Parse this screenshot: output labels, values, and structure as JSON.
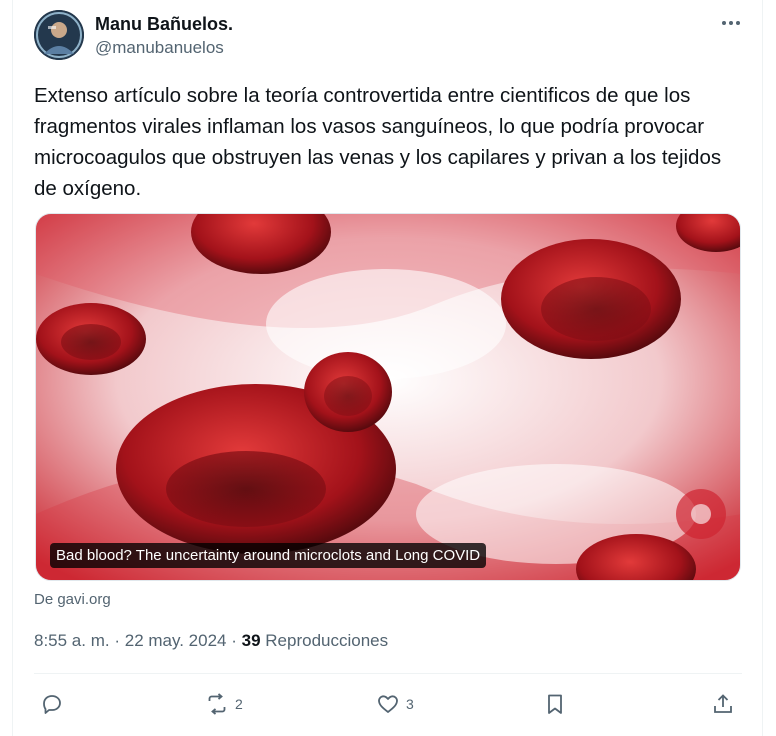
{
  "author": {
    "name": "Manu Bañuelos.",
    "handle": "@manubanuelos"
  },
  "post": {
    "text": "Extenso artículo sobre la teoría controvertida entre cientificos de que los fragmentos virales inflaman los vasos sanguíneos, lo que podría provocar microcoagulos que obstruyen las venas y los capilares y privan a los tejidos de oxígeno.",
    "card": {
      "caption": "Bad blood? The uncertainty around microclots and Long COVID",
      "source": "De gavi.org"
    },
    "time": "8:55 a. m.",
    "date": "22 may. 2024",
    "views_count": "39",
    "views_label": "Reproducciones"
  },
  "actions": {
    "reply_count": "",
    "repost_count": "2",
    "like_count": "3"
  },
  "icons": [
    "more-icon",
    "reply-icon",
    "repost-icon",
    "like-icon",
    "bookmark-icon",
    "share-icon"
  ]
}
